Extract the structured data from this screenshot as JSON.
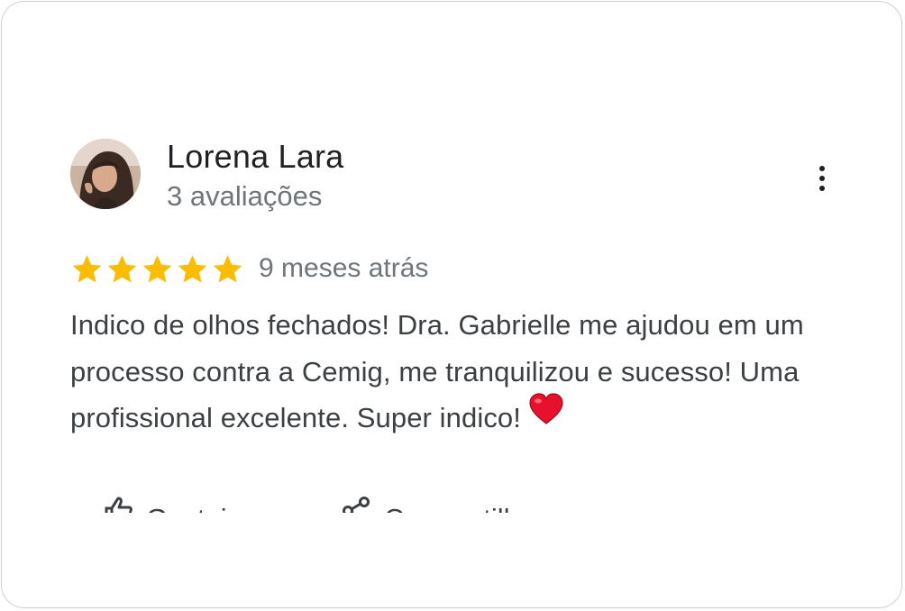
{
  "review": {
    "author_name": "Lorena Lara",
    "author_meta": "3 avaliações",
    "rating": 5,
    "rating_max": 5,
    "date": "9 meses atrás",
    "text": "Indico de olhos fechados! Dra. Gabrielle me ajudou em um processo contra a Cemig, me tranquilizou e sucesso! Uma profissional excelente. Super indico!",
    "emoji": "heart-emoji",
    "star_color": "#fbbc04",
    "heart_color": "#e8112d"
  },
  "actions": {
    "like_label": "Gostei",
    "share_label": "Compartilhar"
  },
  "icons": {
    "more": "more-vert-icon",
    "like": "thumb-up-icon",
    "share": "share-icon",
    "star": "star-icon"
  }
}
